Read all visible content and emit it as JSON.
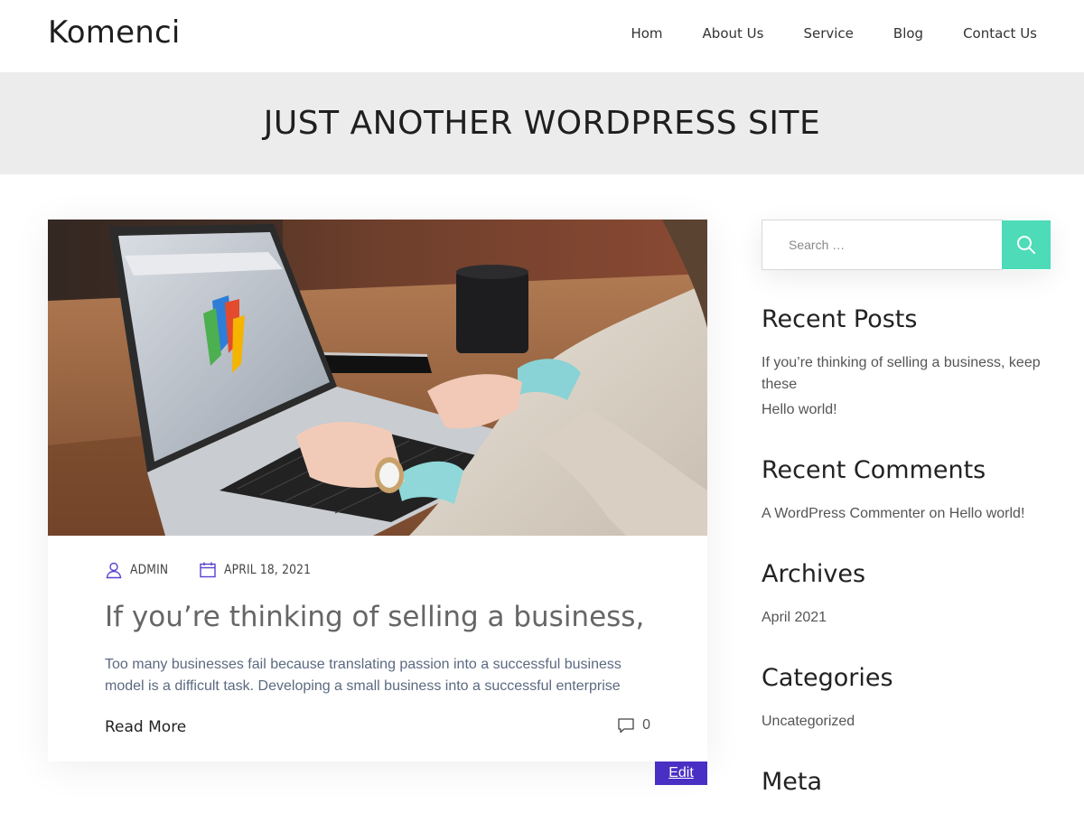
{
  "header": {
    "site_title": "Komenci",
    "nav": [
      "Hom",
      "About Us",
      "Service",
      "Blog",
      "Contact Us"
    ]
  },
  "banner": {
    "title": "JUST ANOTHER WORDPRESS SITE"
  },
  "post": {
    "author": "ADMIN",
    "date": "APRIL 18, 2021",
    "title": "If you’re thinking of selling a business,",
    "excerpt": "Too many businesses fail because translating passion into a successful business model is a difficult task. Developing a small business into a successful enterprise",
    "read_more": "Read More",
    "comment_count": "0",
    "edit_label": "Edit"
  },
  "sidebar": {
    "search_placeholder": "Search …",
    "recent_posts_title": "Recent Posts",
    "recent_posts": [
      "If you’re thinking of selling a business, keep these",
      "Hello world!"
    ],
    "recent_comments_title": "Recent Comments",
    "comment_author": "A WordPress Commenter",
    "comment_on": "on",
    "comment_post": "Hello world!",
    "archives_title": "Archives",
    "archives": [
      "April 2021"
    ],
    "categories_title": "Categories",
    "categories": [
      "Uncategorized"
    ],
    "meta_title": "Meta"
  },
  "colors": {
    "accent_green": "#4ddcb7",
    "edit_purple": "#4a2fc4",
    "banner_bg": "#ececec",
    "meta_icon": "#5b3fd1"
  },
  "icons": {
    "author": "user-icon",
    "date": "calendar-icon",
    "comments": "comment-icon",
    "search": "search-icon"
  }
}
